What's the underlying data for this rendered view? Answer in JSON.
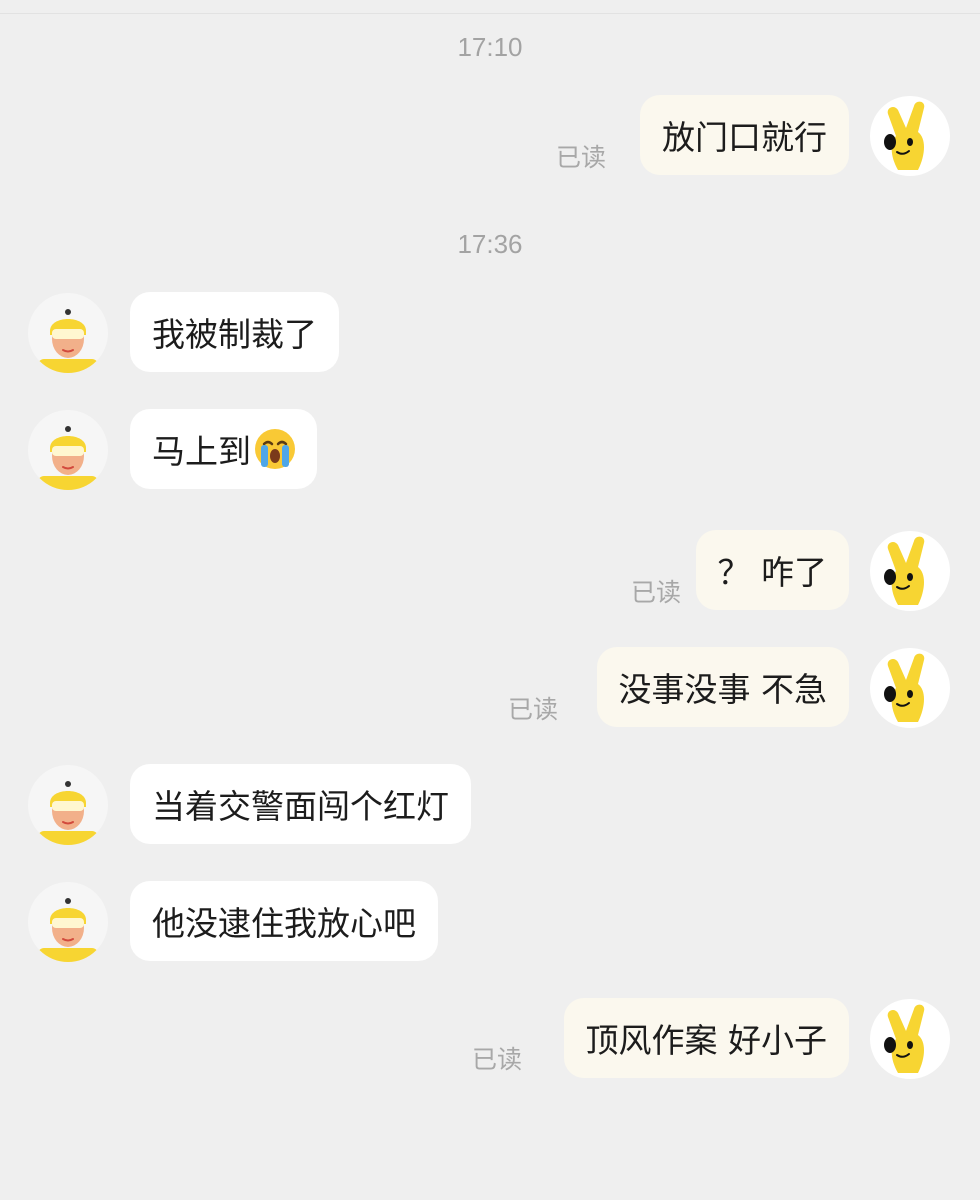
{
  "chat": {
    "timestamps": [
      "17:10",
      "17:36"
    ],
    "read_label": "已读",
    "messages": [
      {
        "side": "me",
        "text": "放门口就行",
        "status": "已读"
      },
      {
        "side": "other",
        "text": "我被制裁了"
      },
      {
        "side": "other",
        "text": "马上到",
        "emoji": "crying-face-emoji"
      },
      {
        "side": "me",
        "text": "？ 咋了",
        "status": "已读"
      },
      {
        "side": "me",
        "text": "没事没事 不急",
        "status": "已读"
      },
      {
        "side": "other",
        "text": "当着交警面闯个红灯"
      },
      {
        "side": "other",
        "text": "他没逮住我放心吧"
      },
      {
        "side": "me",
        "text": "顶风作案 好小子",
        "status": "已读"
      }
    ]
  },
  "colors": {
    "background": "#efefef",
    "my_bubble": "#fbf8ee",
    "their_bubble": "#ffffff",
    "accent_yellow": "#f7d532"
  },
  "icons": {
    "my_avatar": "yellow-hand-mascot-icon",
    "their_avatar": "courier-helmet-avatar-icon"
  }
}
